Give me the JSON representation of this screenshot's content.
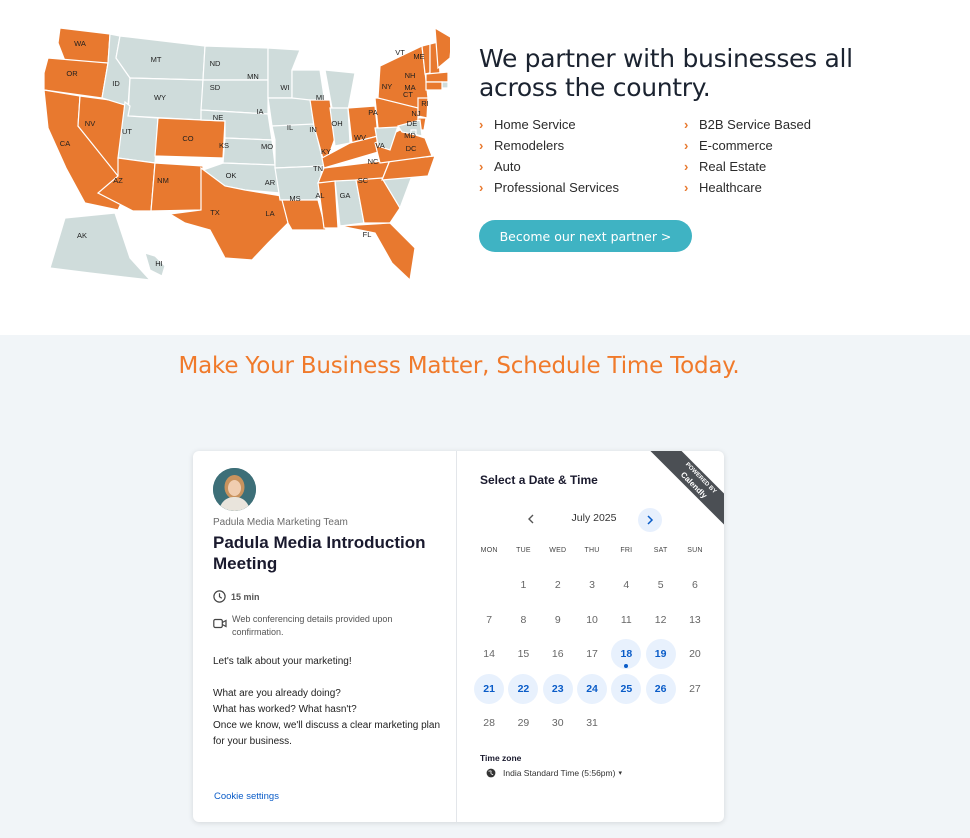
{
  "map": {
    "states": [
      "WA",
      "OR",
      "CA",
      "NV",
      "ID",
      "MT",
      "WY",
      "UT",
      "AZ",
      "CO",
      "NM",
      "ND",
      "SD",
      "NE",
      "KS",
      "OK",
      "TX",
      "MN",
      "IA",
      "MO",
      "AR",
      "LA",
      "WI",
      "IL",
      "MI",
      "IN",
      "OH",
      "KY",
      "TN",
      "MS",
      "AL",
      "GA",
      "FL",
      "SC",
      "NC",
      "VA",
      "WV",
      "PA",
      "NY",
      "VT",
      "NH",
      "ME",
      "MA",
      "RI",
      "CT",
      "NJ",
      "DE",
      "MD",
      "DC",
      "AK",
      "HI"
    ],
    "highlighted": [
      "WA",
      "OR",
      "CA",
      "NV",
      "AZ",
      "CO",
      "NM",
      "TX",
      "LA",
      "MS",
      "GA",
      "FL",
      "IL",
      "OH",
      "KY",
      "TN",
      "NC",
      "VA",
      "PA",
      "NY",
      "VT",
      "NH",
      "ME",
      "MA",
      "CT",
      "NJ",
      "DE"
    ],
    "colors": {
      "highlight": "#e8792f",
      "base": "#cfdcdb",
      "border": "#ffffff"
    }
  },
  "partner": {
    "title": "We partner with businesses all across the country.",
    "industries": [
      "Home Service",
      "B2B Service Based",
      "Remodelers",
      "E-commerce",
      "Auto",
      "Real Estate",
      "Professional Services",
      "Healthcare"
    ],
    "button_label": "Become our next partner >"
  },
  "schedule": {
    "heading": "Make Your Business Matter, Schedule Time Today."
  },
  "calendly": {
    "team_name": "Padula Media Marketing Team",
    "event_title": "Padula Media Introduction Meeting",
    "duration": "15 min",
    "conferencing": "Web conferencing details provided upon confirmation.",
    "description": [
      "Let's talk about your marketing!",
      "",
      "What are you already doing?",
      "What has worked? What hasn't?",
      "Once we know, we'll discuss a clear marketing plan for your business."
    ],
    "cookie_settings": "Cookie settings",
    "select_title": "Select a Date & Time",
    "ribbon_top": "POWERED BY",
    "ribbon_brand": "Calendly",
    "month": "July 2025",
    "days_of_week": [
      "MON",
      "TUE",
      "WED",
      "THU",
      "FRI",
      "SAT",
      "SUN"
    ],
    "weeks": [
      [
        "",
        "1",
        "2",
        "3",
        "4",
        "5",
        "6"
      ],
      [
        "7",
        "8",
        "9",
        "10",
        "11",
        "12",
        "13"
      ],
      [
        "14",
        "15",
        "16",
        "17",
        "18",
        "19",
        "20"
      ],
      [
        "21",
        "22",
        "23",
        "24",
        "25",
        "26",
        "27"
      ],
      [
        "28",
        "29",
        "30",
        "31",
        "",
        "",
        ""
      ]
    ],
    "available_days": [
      "18",
      "19",
      "21",
      "22",
      "23",
      "24",
      "25",
      "26"
    ],
    "today": "18",
    "timezone_label": "Time zone",
    "timezone_value": "India Standard Time (5:56pm)"
  }
}
